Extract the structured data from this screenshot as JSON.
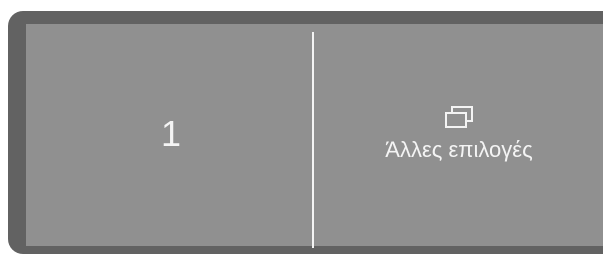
{
  "program_selector": {
    "number_value": "1",
    "more_options": {
      "icon": "windows-stack-icon",
      "label": "Άλλες επιλογές"
    }
  },
  "colors": {
    "frame": "#626262",
    "panel": "#909090",
    "foreground": "#f4f4f4"
  }
}
